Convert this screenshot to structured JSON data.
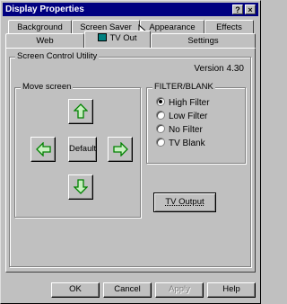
{
  "window": {
    "title": "Display Properties",
    "help_button": "?",
    "close_button": "×"
  },
  "tabs": {
    "row_back": [
      "Background",
      "Screen Saver",
      "Appearance",
      "Effects"
    ],
    "row_front": [
      "Web",
      "TV Out",
      "Settings"
    ],
    "active": "TV Out"
  },
  "panel": {
    "group_title": "Screen Control Utility",
    "version": "Version 4.30",
    "move_screen": {
      "title": "Move screen",
      "default_label": "Default"
    },
    "filter": {
      "title": "FILTER/BLANK",
      "options": [
        "High Filter",
        "Low Filter",
        "No Filter",
        "TV Blank"
      ],
      "selected": "High Filter"
    },
    "tv_output_label": "TV Output"
  },
  "footer": {
    "ok": "OK",
    "cancel": "Cancel",
    "apply": "Apply",
    "help": "Help"
  },
  "colors": {
    "titlebar": "#000080",
    "arrow_fill": "#c8f0c0",
    "arrow_stroke": "#008000"
  }
}
